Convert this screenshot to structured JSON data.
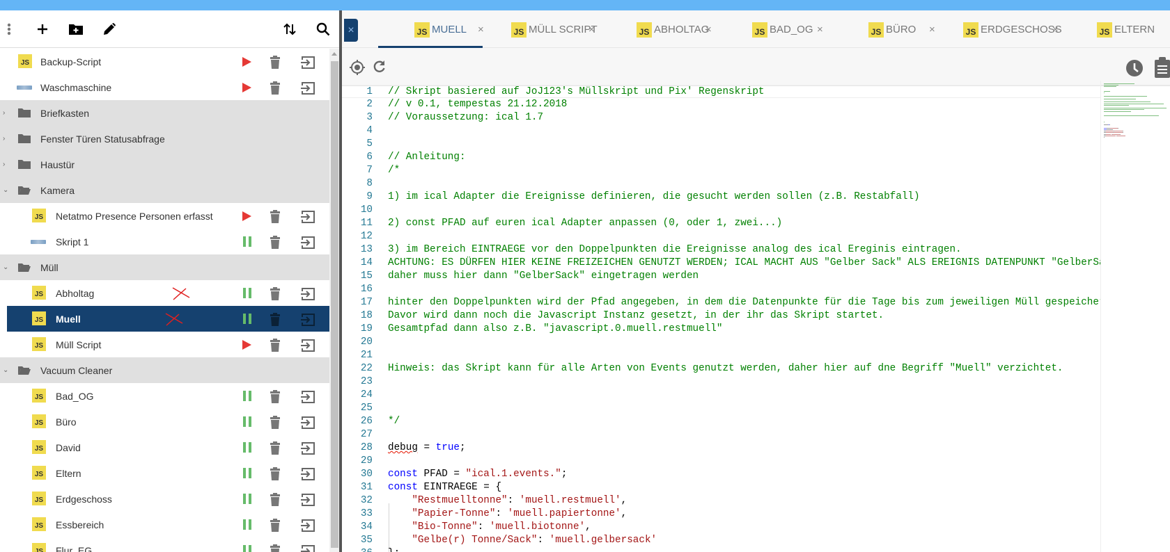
{
  "sidebar": {
    "toolbar": {
      "more": "more-vert",
      "add": "add",
      "add_folder": "create-new-folder",
      "edit": "edit",
      "sort": "sort",
      "search": "search"
    },
    "items": [
      {
        "label": "Backup-Script",
        "kind": "js",
        "level": 0,
        "state": "stopped"
      },
      {
        "label": "Waschmaschine",
        "kind": "blockly",
        "level": 0,
        "state": "stopped"
      },
      {
        "label": "Briefkasten",
        "kind": "folder",
        "open": false
      },
      {
        "label": "Fenster Türen Statusabfrage",
        "kind": "folder",
        "open": false
      },
      {
        "label": "Haustür",
        "kind": "folder",
        "open": false
      },
      {
        "label": "Kamera",
        "kind": "folder",
        "open": true
      },
      {
        "label": "Netatmo Presence Personen erfasst",
        "kind": "js",
        "level": 1,
        "state": "stopped"
      },
      {
        "label": "Skript 1",
        "kind": "blockly",
        "level": 1,
        "state": "running"
      },
      {
        "label": "Müll",
        "kind": "folder",
        "open": true
      },
      {
        "label": "Abholtag",
        "kind": "js",
        "level": 1,
        "state": "running",
        "mark": true
      },
      {
        "label": "Muell",
        "kind": "js",
        "level": 1,
        "state": "running",
        "selected": true,
        "mark": true
      },
      {
        "label": "Müll Script",
        "kind": "js",
        "level": 1,
        "state": "stopped"
      },
      {
        "label": "Vacuum Cleaner",
        "kind": "folder",
        "open": true
      },
      {
        "label": "Bad_OG",
        "kind": "js",
        "level": 1,
        "state": "running"
      },
      {
        "label": "Büro",
        "kind": "js",
        "level": 1,
        "state": "running"
      },
      {
        "label": "David",
        "kind": "js",
        "level": 1,
        "state": "running"
      },
      {
        "label": "Eltern",
        "kind": "js",
        "level": 1,
        "state": "running"
      },
      {
        "label": "Erdgeschoss",
        "kind": "js",
        "level": 1,
        "state": "running"
      },
      {
        "label": "Essbereich",
        "kind": "js",
        "level": 1,
        "state": "running"
      },
      {
        "label": "Flur_EG",
        "kind": "js",
        "level": 1,
        "state": "running"
      }
    ]
  },
  "js_badge": "JS",
  "tabs": [
    {
      "label": "MUELL",
      "active": true,
      "closable": true
    },
    {
      "label": "MÜLL SCRIPT",
      "closable": true
    },
    {
      "label": "ABHOLTAG",
      "closable": true
    },
    {
      "label": "BAD_OG",
      "closable": true
    },
    {
      "label": "BÜRO",
      "closable": true
    },
    {
      "label": "ERDGESCHOSS",
      "closable": true
    },
    {
      "label": "ELTERN",
      "closable": false
    }
  ],
  "close_symbol": "×",
  "colors": {
    "accent": "#15416f",
    "topbar": "#64b5f6",
    "play": "#e53935",
    "pause": "#66bb6a",
    "comment": "#008000",
    "keyword": "#0000ff",
    "string": "#a31515"
  },
  "code": [
    [
      [
        "c",
        "// Skript basiered auf JoJ123's Müllskript und Pix' Regenskript"
      ]
    ],
    [
      [
        "c",
        "// v 0.1, tempestas 21.12.2018"
      ]
    ],
    [
      [
        "c",
        "// Voraussetzung: ical 1.7"
      ]
    ],
    [],
    [],
    [
      [
        "c",
        "// Anleitung:"
      ]
    ],
    [
      [
        "c",
        "/*"
      ]
    ],
    [],
    [
      [
        "c",
        "1) im ical Adapter die Ereignisse definieren, die gesucht werden sollen (z.B. Restabfall)"
      ]
    ],
    [],
    [
      [
        "c",
        "2) const PFAD auf euren ical Adapter anpassen (0, oder 1, zwei...)"
      ]
    ],
    [],
    [
      [
        "c",
        "3) im Bereich EINTRAEGE vor den Doppelpunkten die Ereignisse analog des ical Ereginis eintragen."
      ]
    ],
    [
      [
        "c",
        "ACHTUNG: ES DÜRFEN HIER KEINE FREIZEICHEN GENUTZT WERDEN; ICAL MACHT AUS \"Gelber Sack\" ALS EREIGNIS DATENPUNKT \"GelberSack\""
      ]
    ],
    [
      [
        "c",
        "daher muss hier dann \"GelberSack\" eingetragen werden"
      ]
    ],
    [],
    [
      [
        "c",
        "hinter den Doppelpunkten wird der Pfad angegeben, in dem die Datenpunkte für die Tage bis zum jeweiligen Müll gespeichert werden."
      ]
    ],
    [
      [
        "c",
        "Davor wird dann noch die Javascript Instanz gesetzt, in der ihr das Skript startet."
      ]
    ],
    [
      [
        "c",
        "Gesamtpfad dann also z.B. \"javascript.0.muell.restmuell\""
      ]
    ],
    [],
    [],
    [
      [
        "c",
        "Hinweis: das Skript kann für alle Arten von Events genutzt werden, daher hier auf dne Begriff \"Muell\" verzichtet."
      ]
    ],
    [],
    [],
    [],
    [
      [
        "c",
        "*/"
      ]
    ],
    [],
    [
      [
        "e",
        "debug"
      ],
      [
        "p",
        " = "
      ],
      [
        "k",
        "true"
      ],
      [
        "p",
        ";"
      ]
    ],
    [],
    [
      [
        "k",
        "const"
      ],
      [
        "p",
        " PFAD = "
      ],
      [
        "s",
        "\"ical.1.events.\""
      ],
      [
        "p",
        ";"
      ]
    ],
    [
      [
        "k",
        "const"
      ],
      [
        "p",
        " EINTRAEGE = {"
      ]
    ],
    [
      [
        "p",
        "    "
      ],
      [
        "s",
        "\"Restmuelltonne\""
      ],
      [
        "p",
        ": "
      ],
      [
        "s",
        "'muell.restmuell'"
      ],
      [
        "p",
        ","
      ]
    ],
    [
      [
        "p",
        "    "
      ],
      [
        "s",
        "\"Papier-Tonne\""
      ],
      [
        "p",
        ": "
      ],
      [
        "s",
        "'muell.papiertonne'"
      ],
      [
        "p",
        ","
      ]
    ],
    [
      [
        "p",
        "    "
      ],
      [
        "s",
        "\"Bio-Tonne\""
      ],
      [
        "p",
        ": "
      ],
      [
        "s",
        "'muell.biotonne'"
      ],
      [
        "p",
        ","
      ]
    ],
    [
      [
        "p",
        "    "
      ],
      [
        "s",
        "\"Gelbe(r) Tonne/Sack\""
      ],
      [
        "p",
        ": "
      ],
      [
        "s",
        "'muell.gelbersack'"
      ]
    ],
    [
      [
        "p",
        "};"
      ]
    ]
  ]
}
